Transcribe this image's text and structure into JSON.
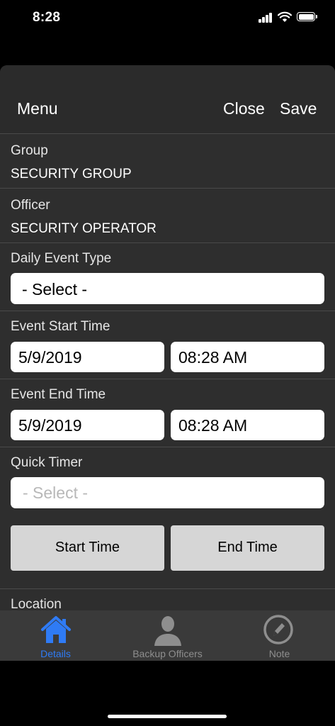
{
  "status_bar": {
    "time": "8:28"
  },
  "nav": {
    "menu_label": "Menu",
    "close_label": "Close",
    "save_label": "Save"
  },
  "group": {
    "label": "Group",
    "value": "SECURITY GROUP"
  },
  "officer": {
    "label": "Officer",
    "value": "SECURITY OPERATOR"
  },
  "daily_event_type": {
    "label": "Daily Event Type",
    "selected": "- Select -"
  },
  "event_start": {
    "label": "Event Start Time",
    "date": "5/9/2019",
    "time": "08:28 AM"
  },
  "event_end": {
    "label": "Event End Time",
    "date": "5/9/2019",
    "time": "08:28 AM"
  },
  "quick_timer": {
    "label": "Quick Timer",
    "placeholder": "- Select -",
    "start_button": "Start Time",
    "end_button": "End Time"
  },
  "location": {
    "label": "Location"
  },
  "tabs": [
    {
      "label": "Details",
      "icon": "home-icon",
      "active": true
    },
    {
      "label": "Backup Officers",
      "icon": "person-icon",
      "active": false
    },
    {
      "label": "Note",
      "icon": "pencil-icon",
      "active": false
    }
  ],
  "colors": {
    "active_tab": "#2f7bf5",
    "inactive_tab": "#8e8e8e",
    "sheet_bg": "#2e2e2e",
    "tab_bar_bg": "#3a3a3a"
  }
}
